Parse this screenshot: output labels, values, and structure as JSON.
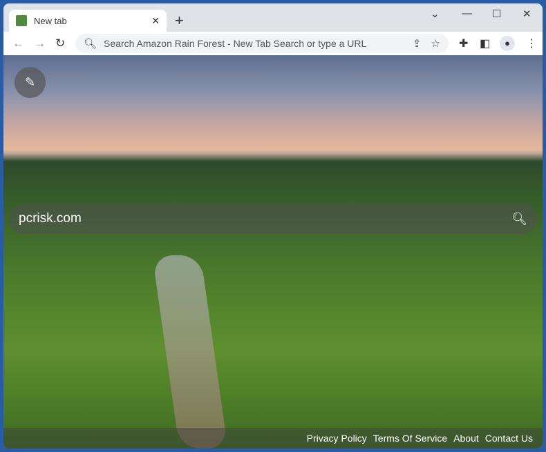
{
  "tab": {
    "title": "New tab",
    "favicon": "frog-icon"
  },
  "toolbar": {
    "omnibox_placeholder": "Search Amazon Rain Forest - New Tab Search or type a URL"
  },
  "page": {
    "search_brand": "pcrisk.com"
  },
  "footer": {
    "links": [
      "Privacy Policy",
      "Terms Of Service",
      "About",
      "Contact Us"
    ]
  },
  "colors": {
    "frame": "#2a5ca6",
    "titlebar": "#dfe3e8"
  }
}
